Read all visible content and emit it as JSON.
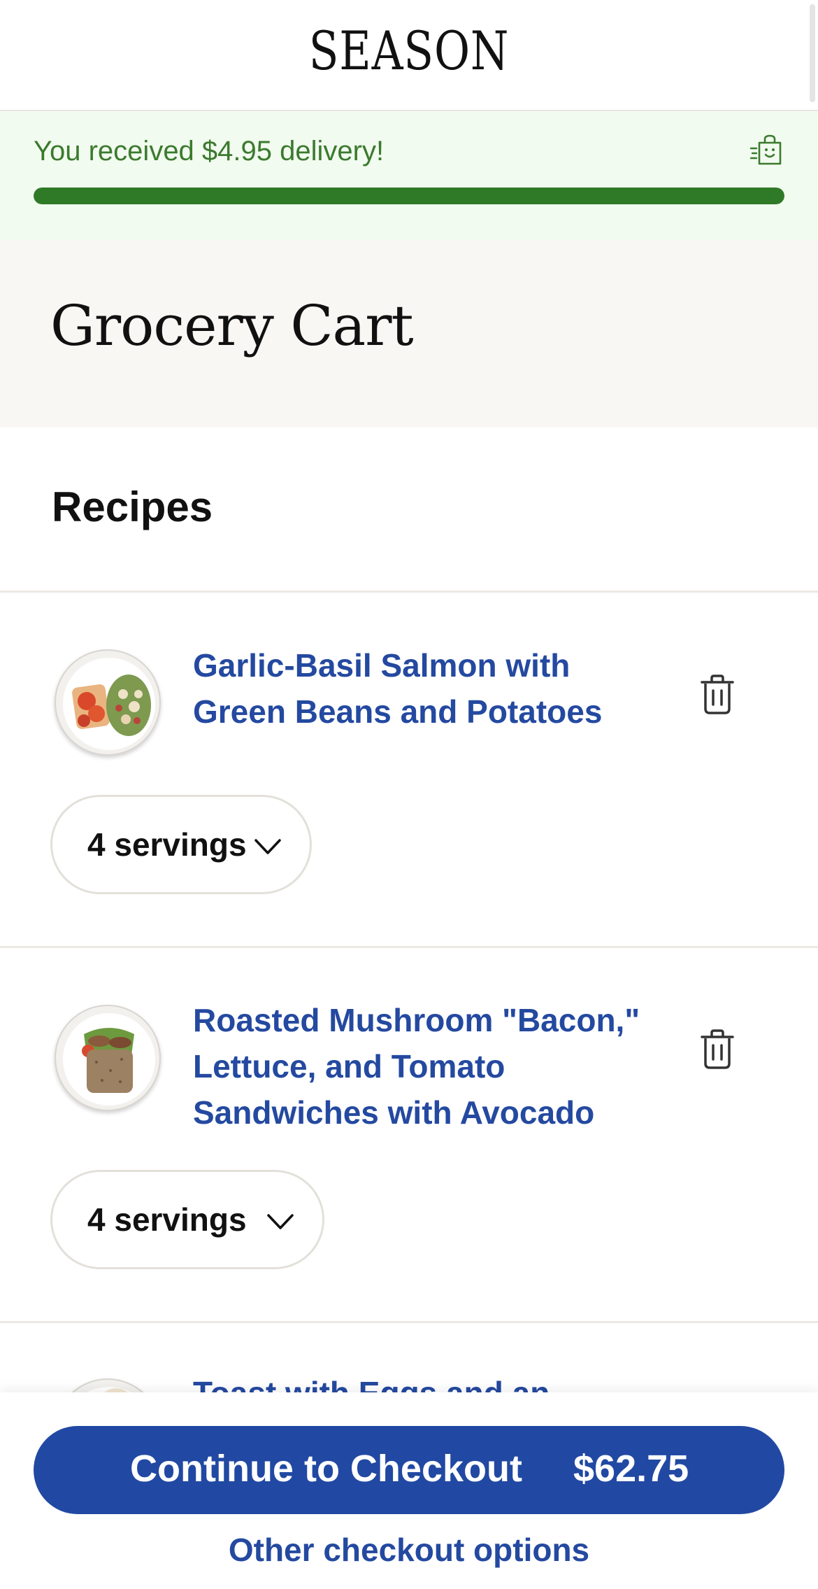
{
  "app": {
    "logo": "SEASON"
  },
  "promo": {
    "message": "You received $4.95 delivery!",
    "progress_fraction": 1.0,
    "icon": "shopping-bag-icon",
    "accent_color": "#2f7a27"
  },
  "page": {
    "title": "Grocery Cart"
  },
  "recipes_section": {
    "title": "Recipes",
    "items": [
      {
        "name": "Garlic-Basil Salmon with Green Beans and Potatoes",
        "servings": "4 servings",
        "thumbnail": "salmon-plate-image"
      },
      {
        "name": "Roasted Mushroom \"Bacon,\" Lettuce, and Tomato Sandwiches with Avocado",
        "servings": "4 servings",
        "thumbnail": "sandwich-plate-image"
      },
      {
        "name": "Toast with Eggs and an",
        "thumbnail": "toast-plate-image"
      }
    ]
  },
  "footer": {
    "checkout_label": "Continue to Checkout",
    "checkout_total": "$62.75",
    "other_options": "Other checkout options",
    "button_color": "#2149a3"
  }
}
